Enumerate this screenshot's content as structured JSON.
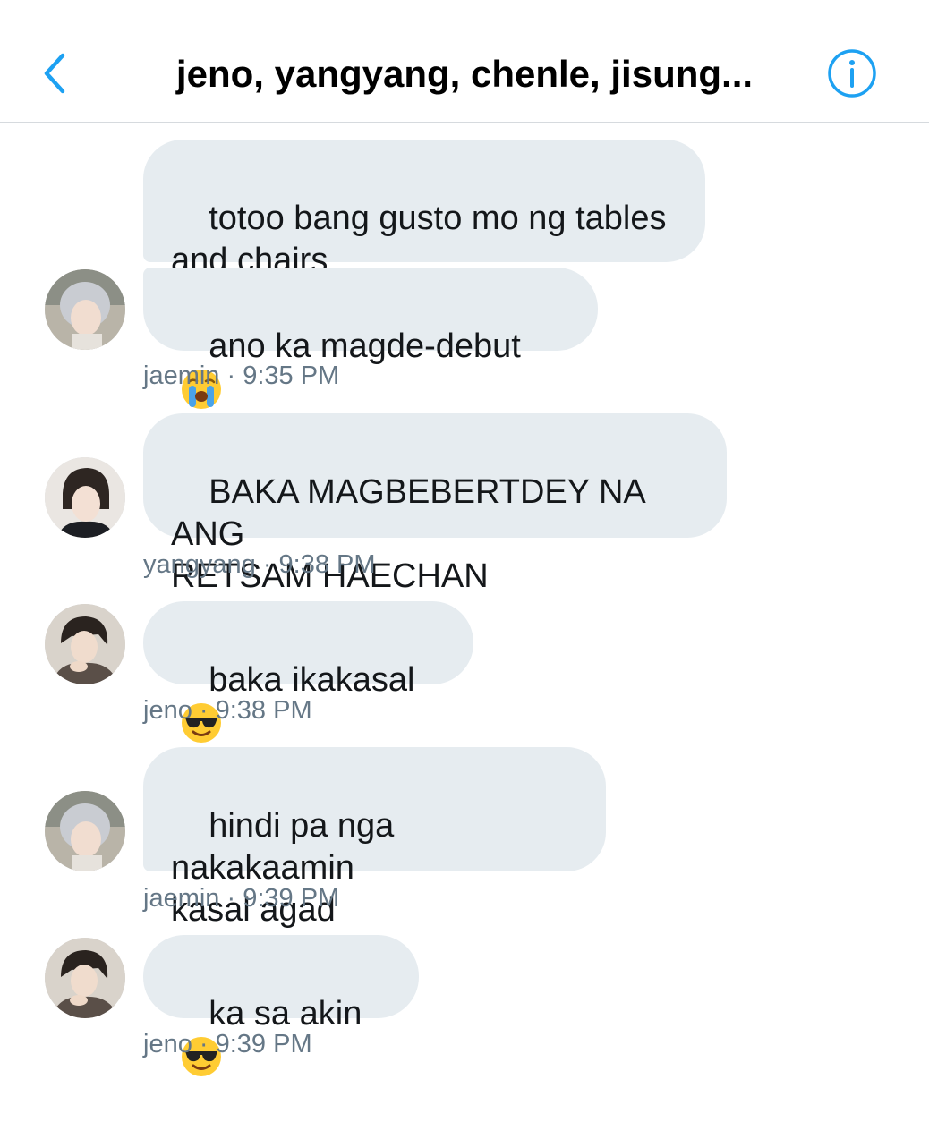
{
  "header": {
    "title": "jeno, yangyang, chenle, jisung...",
    "back_icon": "chevron-left-icon",
    "info_icon": "info-circle-icon",
    "accent_color": "#1da1f2"
  },
  "messages": [
    {
      "text": "totoo bang gusto mo ng tables\nand chairs"
    },
    {
      "text": "ano ka magde-debut",
      "emoji": "loudly-crying-face-icon"
    },
    {
      "text": "BAKA MAGBEBERTDEY NA ANG\nRETSAM HAECHAN"
    },
    {
      "text": "baka ikakasal",
      "emoji": "sunglasses-face-icon"
    },
    {
      "text": "hindi pa nga nakakaamin\nkasal agad"
    },
    {
      "text": "ka sa akin",
      "emoji": "sunglasses-face-icon"
    }
  ],
  "meta": [
    "jaemin · 9:35 PM",
    "yangyang · 9:38 PM",
    "jeno · 9:38 PM",
    "jaemin · 9:39 PM",
    "jeno · 9:39 PM"
  ],
  "bubble_color": "#e6ecf0",
  "meta_color": "#657786"
}
